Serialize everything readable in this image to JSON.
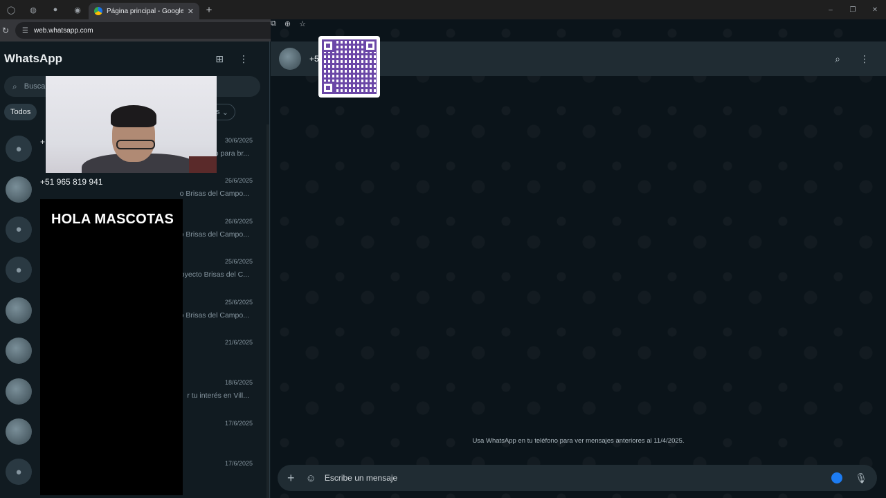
{
  "browser": {
    "active_tab_title": "Página principal - Google Drive",
    "url": "web.whatsapp.com"
  },
  "sidebar": {
    "brand": "WhatsApp",
    "search_placeholder": "Buscar",
    "filters": [
      "Todos"
    ],
    "filter_more_label": "as",
    "chats": [
      {
        "name": "+",
        "date": "30/6/2025",
        "preview": "o para br..."
      },
      {
        "name": "+51 965 819 941",
        "date": "26/6/2025",
        "preview": "o Brisas del Campo..."
      },
      {
        "name": "",
        "date": "26/6/2025",
        "preview": "o Brisas del Campo..."
      },
      {
        "name": "",
        "date": "25/6/2025",
        "preview": "oyecto Brisas del C..."
      },
      {
        "name": "",
        "date": "25/6/2025",
        "preview": "o Brisas del Campo..."
      },
      {
        "name": "",
        "date": "21/6/2025",
        "preview": ""
      },
      {
        "name": "",
        "date": "18/6/2025",
        "preview": "r tu interés en Vill..."
      },
      {
        "name": "",
        "date": "17/6/2025",
        "preview": ""
      },
      {
        "name": "",
        "date": "17/6/2025",
        "preview": ""
      }
    ]
  },
  "conversation": {
    "contact_label": "+5",
    "notice": "Usa WhatsApp en tu teléfono para ver mensajes anteriores al 11/4/2025.",
    "composer_placeholder": "Escribe un mensaje"
  },
  "overlay": {
    "title": "HOLA MASCOTAS"
  }
}
